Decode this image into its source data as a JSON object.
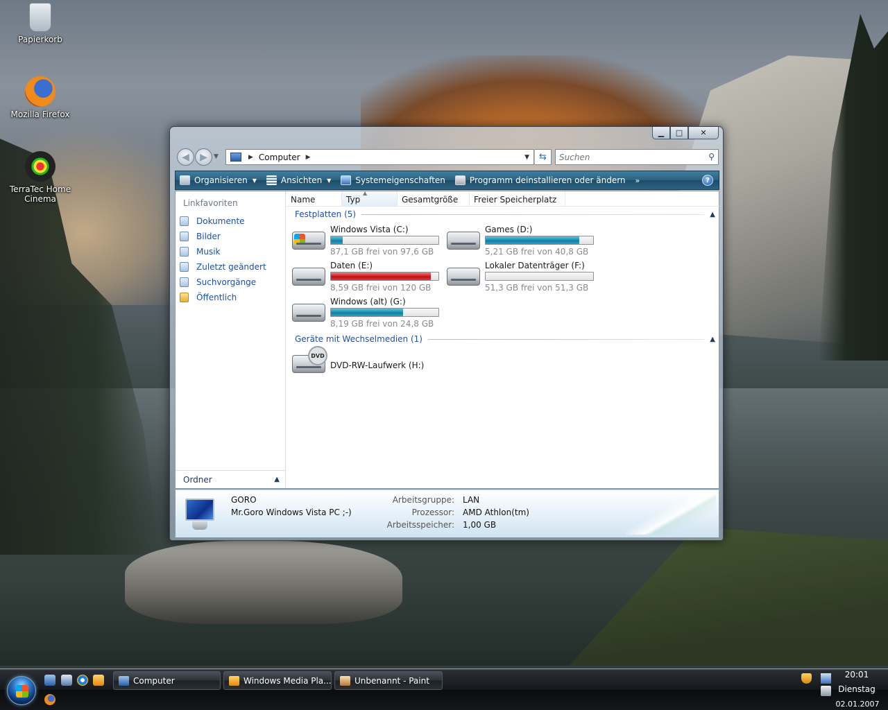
{
  "desktop": {
    "icons": [
      {
        "label": "Papierkorb"
      },
      {
        "label": "Mozilla Firefox"
      },
      {
        "label": "TerraTec Home Cinema"
      }
    ]
  },
  "window": {
    "controls": {
      "minimize": "▁",
      "maximize": "□",
      "close": "✕"
    },
    "address": {
      "location": "Computer"
    },
    "search": {
      "placeholder": "Suchen"
    },
    "toolbar": {
      "organize": "Organisieren",
      "views": "Ansichten",
      "system_properties": "Systemeigenschaften",
      "uninstall": "Programm deinstallieren oder ändern",
      "more": "»",
      "help": "?"
    },
    "sidebar": {
      "heading": "Linkfavoriten",
      "items": [
        "Dokumente",
        "Bilder",
        "Musik",
        "Zuletzt geändert",
        "Suchvorgänge",
        "Öffentlich"
      ],
      "folders_label": "Ordner"
    },
    "columns": [
      "Name",
      "Typ",
      "Gesamtgröße",
      "Freier Speicherplatz"
    ],
    "groups": {
      "hard_drives": "Festplatten (5)",
      "removable": "Geräte mit Wechselmedien (1)"
    },
    "drives": [
      {
        "name": "Windows Vista (C:)",
        "free": "87,1 GB frei von 97,6 GB",
        "used_fraction": 0.11,
        "color": "#1b8fb5"
      },
      {
        "name": "Games (D:)",
        "free": "5,21 GB frei von 40,8 GB",
        "used_fraction": 0.87,
        "color": "#1b8fb5"
      },
      {
        "name": "Daten (E:)",
        "free": "8,59 GB frei von 120 GB",
        "used_fraction": 0.93,
        "color": "#d4191b"
      },
      {
        "name": "Lokaler Datenträger (F:)",
        "free": "51,3 GB frei von 51,3 GB",
        "used_fraction": 0.0,
        "color": "#1b8fb5"
      },
      {
        "name": "Windows (alt) (G:)",
        "free": "8,19 GB frei von 24,8 GB",
        "used_fraction": 0.67,
        "color": "#1b8fb5"
      }
    ],
    "removable": [
      {
        "name": "DVD-RW-Laufwerk (H:)",
        "badge": "DVD"
      }
    ],
    "details": {
      "computer_name": "GORO",
      "description": "Mr.Goro Windows Vista PC ;-)",
      "workgroup_label": "Arbeitsgruppe:",
      "workgroup": "LAN",
      "processor_label": "Prozessor:",
      "processor": "AMD Athlon(tm)",
      "memory_label": "Arbeitsspeicher:",
      "memory": "1,00 GB"
    }
  },
  "taskbar": {
    "buttons": [
      "Computer",
      "Windows Media Pla...",
      "Unbenannt - Paint"
    ],
    "clock": {
      "time": "20:01",
      "day": "Dienstag",
      "date": "02.01.2007"
    }
  }
}
